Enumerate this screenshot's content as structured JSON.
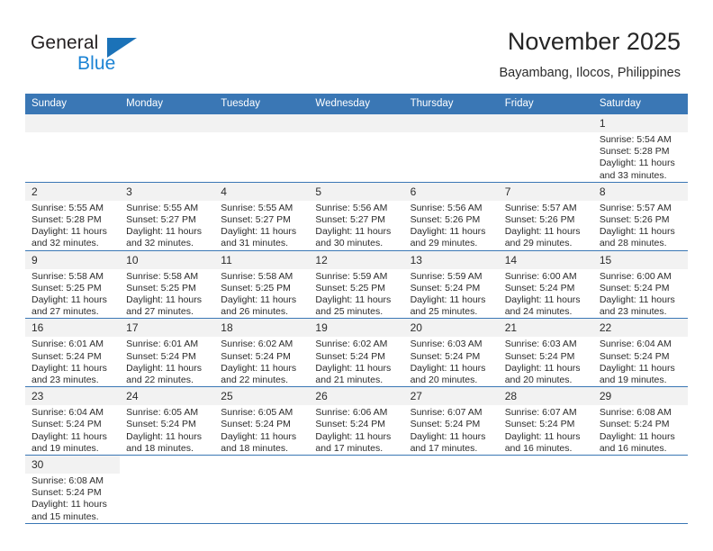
{
  "brand": {
    "name_top": "General",
    "name_bottom": "Blue",
    "flag_icon": "triangle-flag-icon",
    "color_dark": "#231f20",
    "color_blue": "#1b83d4"
  },
  "header": {
    "title": "November 2025",
    "subtitle": "Bayambang, Ilocos, Philippines"
  },
  "calendar": {
    "header_bg": "#3a77b5",
    "daynum_bg": "#f2f2f2",
    "weekdays": [
      "Sunday",
      "Monday",
      "Tuesday",
      "Wednesday",
      "Thursday",
      "Friday",
      "Saturday"
    ],
    "weeks": [
      [
        {
          "day": "",
          "lines": []
        },
        {
          "day": "",
          "lines": []
        },
        {
          "day": "",
          "lines": []
        },
        {
          "day": "",
          "lines": []
        },
        {
          "day": "",
          "lines": []
        },
        {
          "day": "",
          "lines": []
        },
        {
          "day": "1",
          "lines": [
            "Sunrise: 5:54 AM",
            "Sunset: 5:28 PM",
            "Daylight: 11 hours",
            "and 33 minutes."
          ]
        }
      ],
      [
        {
          "day": "2",
          "lines": [
            "Sunrise: 5:55 AM",
            "Sunset: 5:28 PM",
            "Daylight: 11 hours",
            "and 32 minutes."
          ]
        },
        {
          "day": "3",
          "lines": [
            "Sunrise: 5:55 AM",
            "Sunset: 5:27 PM",
            "Daylight: 11 hours",
            "and 32 minutes."
          ]
        },
        {
          "day": "4",
          "lines": [
            "Sunrise: 5:55 AM",
            "Sunset: 5:27 PM",
            "Daylight: 11 hours",
            "and 31 minutes."
          ]
        },
        {
          "day": "5",
          "lines": [
            "Sunrise: 5:56 AM",
            "Sunset: 5:27 PM",
            "Daylight: 11 hours",
            "and 30 minutes."
          ]
        },
        {
          "day": "6",
          "lines": [
            "Sunrise: 5:56 AM",
            "Sunset: 5:26 PM",
            "Daylight: 11 hours",
            "and 29 minutes."
          ]
        },
        {
          "day": "7",
          "lines": [
            "Sunrise: 5:57 AM",
            "Sunset: 5:26 PM",
            "Daylight: 11 hours",
            "and 29 minutes."
          ]
        },
        {
          "day": "8",
          "lines": [
            "Sunrise: 5:57 AM",
            "Sunset: 5:26 PM",
            "Daylight: 11 hours",
            "and 28 minutes."
          ]
        }
      ],
      [
        {
          "day": "9",
          "lines": [
            "Sunrise: 5:58 AM",
            "Sunset: 5:25 PM",
            "Daylight: 11 hours",
            "and 27 minutes."
          ]
        },
        {
          "day": "10",
          "lines": [
            "Sunrise: 5:58 AM",
            "Sunset: 5:25 PM",
            "Daylight: 11 hours",
            "and 27 minutes."
          ]
        },
        {
          "day": "11",
          "lines": [
            "Sunrise: 5:58 AM",
            "Sunset: 5:25 PM",
            "Daylight: 11 hours",
            "and 26 minutes."
          ]
        },
        {
          "day": "12",
          "lines": [
            "Sunrise: 5:59 AM",
            "Sunset: 5:25 PM",
            "Daylight: 11 hours",
            "and 25 minutes."
          ]
        },
        {
          "day": "13",
          "lines": [
            "Sunrise: 5:59 AM",
            "Sunset: 5:24 PM",
            "Daylight: 11 hours",
            "and 25 minutes."
          ]
        },
        {
          "day": "14",
          "lines": [
            "Sunrise: 6:00 AM",
            "Sunset: 5:24 PM",
            "Daylight: 11 hours",
            "and 24 minutes."
          ]
        },
        {
          "day": "15",
          "lines": [
            "Sunrise: 6:00 AM",
            "Sunset: 5:24 PM",
            "Daylight: 11 hours",
            "and 23 minutes."
          ]
        }
      ],
      [
        {
          "day": "16",
          "lines": [
            "Sunrise: 6:01 AM",
            "Sunset: 5:24 PM",
            "Daylight: 11 hours",
            "and 23 minutes."
          ]
        },
        {
          "day": "17",
          "lines": [
            "Sunrise: 6:01 AM",
            "Sunset: 5:24 PM",
            "Daylight: 11 hours",
            "and 22 minutes."
          ]
        },
        {
          "day": "18",
          "lines": [
            "Sunrise: 6:02 AM",
            "Sunset: 5:24 PM",
            "Daylight: 11 hours",
            "and 22 minutes."
          ]
        },
        {
          "day": "19",
          "lines": [
            "Sunrise: 6:02 AM",
            "Sunset: 5:24 PM",
            "Daylight: 11 hours",
            "and 21 minutes."
          ]
        },
        {
          "day": "20",
          "lines": [
            "Sunrise: 6:03 AM",
            "Sunset: 5:24 PM",
            "Daylight: 11 hours",
            "and 20 minutes."
          ]
        },
        {
          "day": "21",
          "lines": [
            "Sunrise: 6:03 AM",
            "Sunset: 5:24 PM",
            "Daylight: 11 hours",
            "and 20 minutes."
          ]
        },
        {
          "day": "22",
          "lines": [
            "Sunrise: 6:04 AM",
            "Sunset: 5:24 PM",
            "Daylight: 11 hours",
            "and 19 minutes."
          ]
        }
      ],
      [
        {
          "day": "23",
          "lines": [
            "Sunrise: 6:04 AM",
            "Sunset: 5:24 PM",
            "Daylight: 11 hours",
            "and 19 minutes."
          ]
        },
        {
          "day": "24",
          "lines": [
            "Sunrise: 6:05 AM",
            "Sunset: 5:24 PM",
            "Daylight: 11 hours",
            "and 18 minutes."
          ]
        },
        {
          "day": "25",
          "lines": [
            "Sunrise: 6:05 AM",
            "Sunset: 5:24 PM",
            "Daylight: 11 hours",
            "and 18 minutes."
          ]
        },
        {
          "day": "26",
          "lines": [
            "Sunrise: 6:06 AM",
            "Sunset: 5:24 PM",
            "Daylight: 11 hours",
            "and 17 minutes."
          ]
        },
        {
          "day": "27",
          "lines": [
            "Sunrise: 6:07 AM",
            "Sunset: 5:24 PM",
            "Daylight: 11 hours",
            "and 17 minutes."
          ]
        },
        {
          "day": "28",
          "lines": [
            "Sunrise: 6:07 AM",
            "Sunset: 5:24 PM",
            "Daylight: 11 hours",
            "and 16 minutes."
          ]
        },
        {
          "day": "29",
          "lines": [
            "Sunrise: 6:08 AM",
            "Sunset: 5:24 PM",
            "Daylight: 11 hours",
            "and 16 minutes."
          ]
        }
      ],
      [
        {
          "day": "30",
          "lines": [
            "Sunrise: 6:08 AM",
            "Sunset: 5:24 PM",
            "Daylight: 11 hours",
            "and 15 minutes."
          ]
        },
        {
          "day": "",
          "lines": []
        },
        {
          "day": "",
          "lines": []
        },
        {
          "day": "",
          "lines": []
        },
        {
          "day": "",
          "lines": []
        },
        {
          "day": "",
          "lines": []
        },
        {
          "day": "",
          "lines": []
        }
      ]
    ]
  }
}
